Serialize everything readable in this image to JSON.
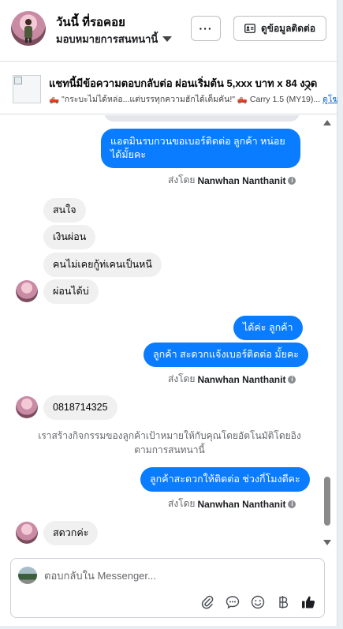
{
  "header": {
    "contact_name": "วันนี้ ที่รอคอย",
    "assignee": "มอบหมายการสนทนานี้",
    "more_label": "···",
    "contact_info_label": "ดูข้อมูลติดต่อ"
  },
  "ad": {
    "title": "แชทนี้มีข้อความตอบกลับต่อ ผ่อนเริ่มต้น 5,xxx บาท x 84 งวด",
    "subtitle": "🛻 \"กระบะไม่ได้หล่อ...แต่บรรทุกความฮักได้เต็มคัน!\" 🛻 Carry 1.5 (MY19)...",
    "link": "ดูโฆ",
    "close": "✕"
  },
  "messages": [
    {
      "side": "out",
      "text": "แอดมินรบกวนขอเบอร์ติดต่อ ลูกค้า หน่อยได้มั้ยคะ"
    },
    {
      "side": "in",
      "text": "สนใจ"
    },
    {
      "side": "in",
      "text": "เงินผ่อน"
    },
    {
      "side": "in",
      "text": "คนไม่เคยกู้ท่เคนเป็นหนี"
    },
    {
      "side": "in",
      "text": "ผ่อนได้บ่"
    },
    {
      "side": "out",
      "text": "ได้ค่ะ ลูกค้า"
    },
    {
      "side": "out",
      "text": "ลูกค้า สะดวกแจ้งเบอร์ติดต่อ มั้ยคะ"
    },
    {
      "side": "in",
      "text": "0818714325"
    },
    {
      "side": "out",
      "text": "ลูกค้าสะดวกให้ติดต่อ ช่วงกี่โมงดีคะ"
    },
    {
      "side": "in",
      "text": "สดวกค่ะ"
    }
  ],
  "sent_by": {
    "prefix": "ส่งโดย",
    "name": "Nanwhan Nanthanit"
  },
  "system_note": "เราสร้างกิจกรรมของลูกค้าเป้าหมายให้กับคุณโดยอัตโนมัติโดยอิงตามการสนทนานี้",
  "composer": {
    "placeholder": "ตอบกลับใน Messenger..."
  },
  "colors": {
    "outgoing": "#0a7cff",
    "incoming": "#f0f0f0",
    "thumb_up": "#1c1e21"
  }
}
